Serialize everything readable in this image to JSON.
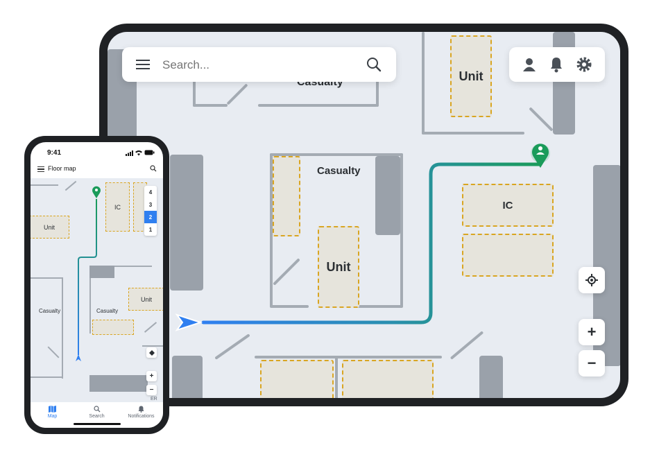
{
  "tablet": {
    "search": {
      "placeholder": "Search..."
    },
    "rooms": {
      "unit_top": "Unit",
      "casualty_top": "Casualty",
      "casualty_center": "Casualty",
      "unit_center": "Unit",
      "ic": "IC"
    },
    "controls": {
      "zoom_in": "+",
      "zoom_out": "−"
    },
    "icons": [
      "menu-icon",
      "search-icon",
      "user-icon",
      "bell-icon",
      "gear-icon",
      "locate-icon",
      "location-pin-icon",
      "navigation-arrow-icon"
    ],
    "route_colors": {
      "start": "#2f7ff0",
      "end": "#1a9b5a"
    }
  },
  "phone": {
    "status": {
      "time": "9:41"
    },
    "header": {
      "title": "Floor map"
    },
    "floors": [
      "4",
      "3",
      "2",
      "1"
    ],
    "selected_floor": "2",
    "rooms": {
      "ic": "IC",
      "unit_left": "Unit",
      "casualty_left": "Casualty",
      "casualty_center": "Casualty",
      "unit_right": "Unit"
    },
    "controls": {
      "zoom_in": "+",
      "zoom_out": "−",
      "er": "ER"
    },
    "nav": [
      {
        "label": "Map",
        "active": true
      },
      {
        "label": "Search",
        "active": false
      },
      {
        "label": "Notifications",
        "active": false
      }
    ]
  }
}
